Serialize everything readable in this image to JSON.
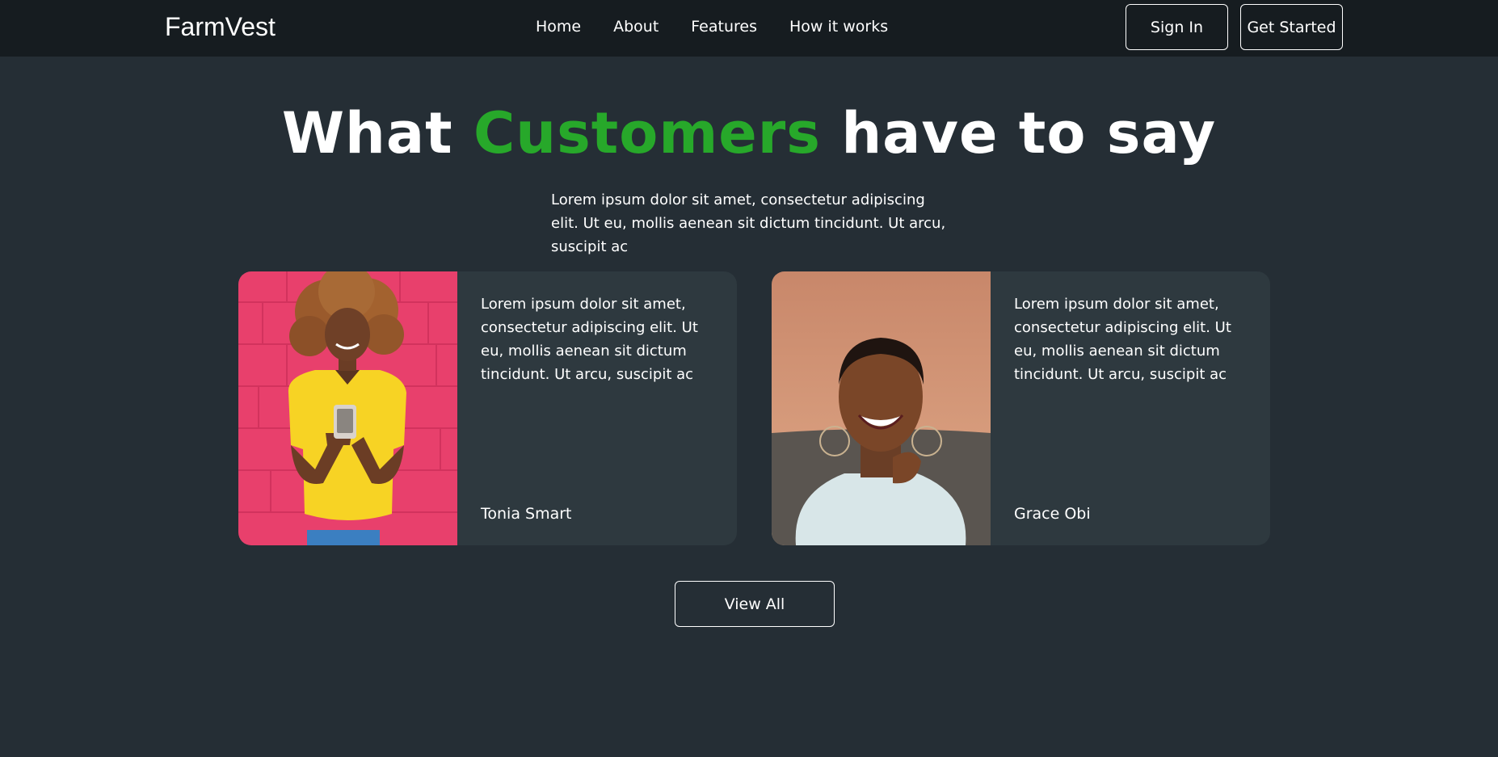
{
  "nav": {
    "logo": "FarmVest",
    "links": [
      "Home",
      "About",
      "Features",
      "How it works"
    ],
    "sign_in": "Sign In",
    "get_started": "Get Started"
  },
  "hero": {
    "title_part1": "What ",
    "title_accent": "Customers",
    "title_part2": " have to say",
    "subtitle": "Lorem ipsum dolor sit amet, consectetur adipiscing elit. Ut eu, mollis aenean sit dictum tincidunt. Ut arcu, suscipit ac"
  },
  "testimonials": [
    {
      "text": "Lorem ipsum dolor sit amet, consectetur adipiscing elit. Ut eu, mollis aenean sit dictum tincidunt. Ut arcu, suscipit ac",
      "name": "Tonia Smart"
    },
    {
      "text": "Lorem ipsum dolor sit amet, consectetur adipiscing elit. Ut eu, mollis aenean sit dictum tincidunt. Ut arcu, suscipit ac",
      "name": "Grace Obi"
    }
  ],
  "view_all": "View All",
  "colors": {
    "accent": "#27a82a",
    "background": "#252e35",
    "navbar": "#161c20",
    "card": "#2e393f"
  }
}
